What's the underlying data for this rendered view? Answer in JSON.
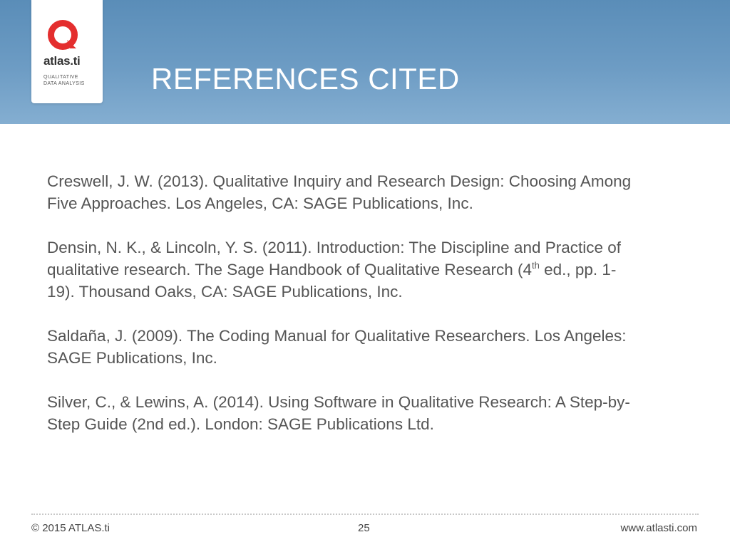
{
  "header": {
    "title": "REFERENCES CITED",
    "logo": {
      "name": "atlas.ti",
      "tagline": "QUALITATIVE\nDATA ANALYSIS",
      "icon": "atlasti-logo-icon",
      "brand_color": "#e42e2e"
    },
    "background_color": "#6d9cc4"
  },
  "references": [
    {
      "text": "Creswell, J. W. (2013). Qualitative Inquiry and Research Design: Choosing Among Five Approaches. Los Angeles, CA: SAGE Publications, Inc."
    },
    {
      "before": "Densin, N. K., & Lincoln, Y. S. (2011). Introduction: The Discipline and Practice of qualitative research.  The Sage Handbook of Qualitative Research (4",
      "sup": "th",
      "after": " ed., pp. 1-19). Thousand Oaks, CA: SAGE Publications, Inc."
    },
    {
      "text": "Saldaña, J. (2009). The Coding Manual for Qualitative Researchers. Los Angeles: SAGE Publications, Inc."
    },
    {
      "text": "Silver, C., & Lewins, A. (2014). Using Software in Qualitative Research: A Step-by-Step Guide (2nd ed.). London: SAGE Publications Ltd."
    }
  ],
  "footer": {
    "copyright": "© 2015 ATLAS.ti",
    "page_number": "25",
    "website": "www.atlasti.com"
  }
}
